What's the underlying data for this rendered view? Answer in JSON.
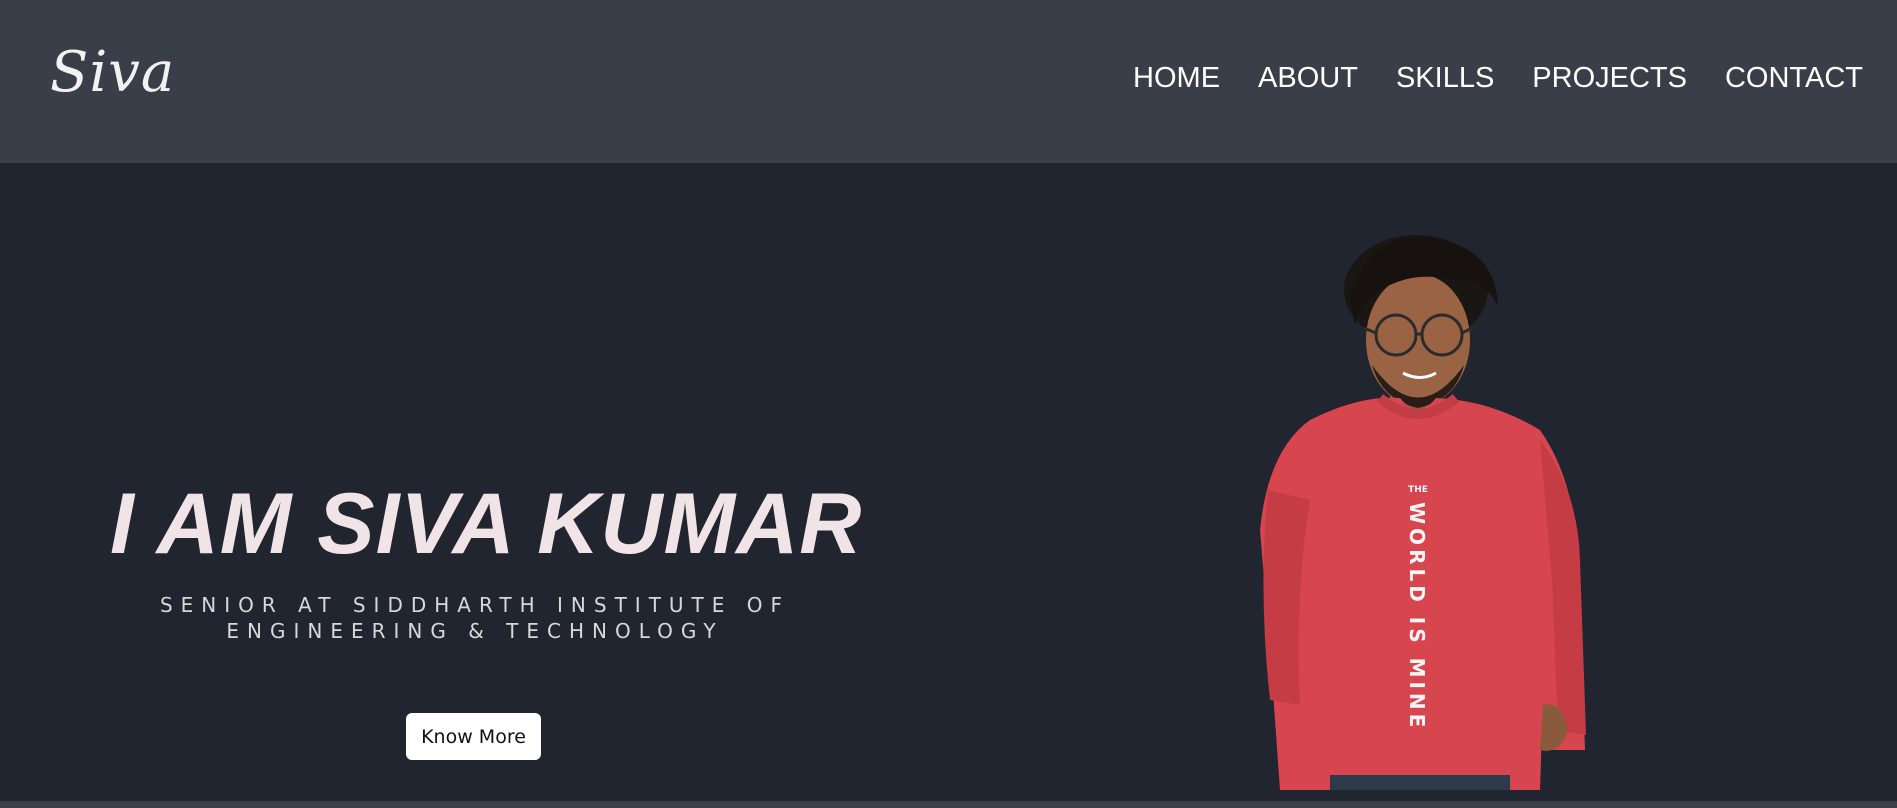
{
  "header": {
    "logo": "Siva",
    "nav": [
      "HOME",
      "ABOUT",
      "SKILLS",
      "PROJECTS",
      "CONTACT"
    ]
  },
  "hero": {
    "title": "I AM SIVA KUMAR",
    "subtitle_line1": "SENIOR AT SIDDHARTH INSTITUTE OF",
    "subtitle_line2": "ENGINEERING & TECHNOLOGY",
    "button": "Know More",
    "photo": {
      "shirt_print_small": "THE",
      "shirt_print": "WORLD IS MINE"
    }
  },
  "colors": {
    "navbar": "#3a3e49",
    "background": "#21252f",
    "headline": "#f1e4e6",
    "shirt": "#d7464f"
  }
}
